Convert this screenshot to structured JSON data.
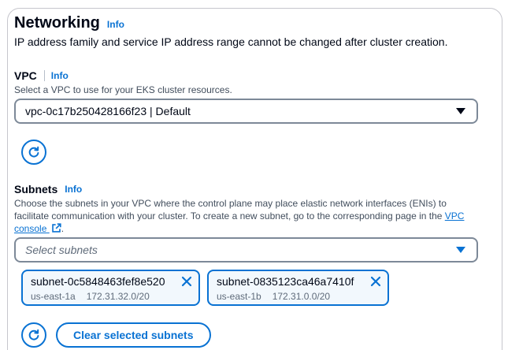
{
  "networking": {
    "title": "Networking",
    "info": "Info",
    "description": "IP address family and service IP address range cannot be changed after cluster creation."
  },
  "vpc": {
    "label": "VPC",
    "info": "Info",
    "description": "Select a VPC to use for your EKS cluster resources.",
    "selected": "vpc-0c17b250428166f23 | Default",
    "refresh_icon": "refresh-icon"
  },
  "subnets": {
    "label": "Subnets",
    "info": "Info",
    "description_part1": "Choose the subnets in your VPC where the control plane may place elastic network interfaces (ENIs) to facilitate communication with your cluster. To create a new subnet, go to the corresponding page in the",
    "vpc_console_link": "VPC console",
    "description_end": ".",
    "placeholder": "Select subnets",
    "selected": [
      {
        "id": "subnet-0c5848463fef8e520",
        "az": "us-east-1a",
        "cidr": "172.31.32.0/20"
      },
      {
        "id": "subnet-0835123ca46a7410f",
        "az": "us-east-1b",
        "cidr": "172.31.0.0/20"
      }
    ],
    "clear_button": "Clear selected subnets",
    "refresh_icon": "refresh-icon",
    "external_link_icon": "external-link-icon",
    "remove_icon": "close-icon"
  },
  "colors": {
    "accent": "#0972d3",
    "text": "#000716",
    "muted": "#5f6b7a",
    "border": "#7d8998",
    "token_bg": "#f2f8fd"
  }
}
